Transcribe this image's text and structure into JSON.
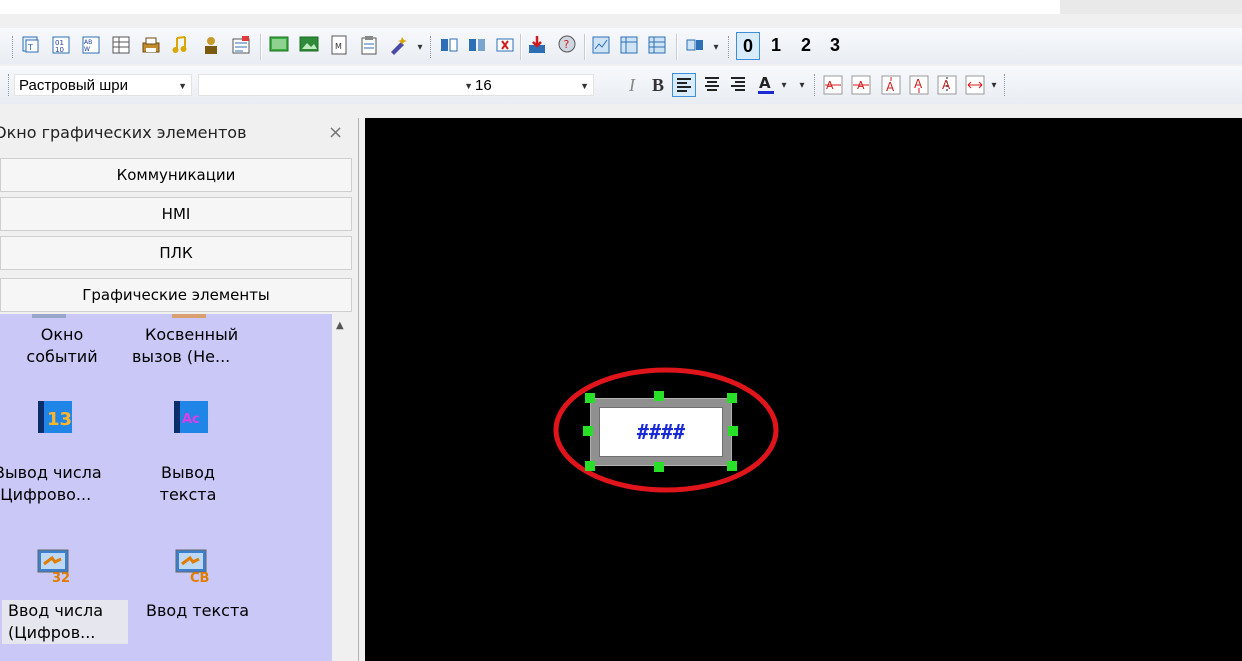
{
  "toolbar2": {
    "font_name": "Растровый шри",
    "font_size": "16",
    "italic": "I",
    "bold": "B"
  },
  "layer_numbers": [
    "0",
    "1",
    "2",
    "3"
  ],
  "panel": {
    "title": "Окно графических элементов",
    "close": "×",
    "categories": [
      "Коммуникации",
      "HMI",
      "ПЛК",
      "Графические элементы"
    ],
    "items": [
      {
        "label1": "Окно",
        "label2": "событий",
        "icon": "event-window-icon"
      },
      {
        "label1": "Косвенный",
        "label2": "вызов (Не...",
        "icon": "indirect-call-icon"
      },
      {
        "label1": "Вывод числа",
        "label2": "(Цифрово...",
        "icon": "numeric-display-icon"
      },
      {
        "label1": "Вывод",
        "label2": "текста",
        "icon": "text-display-icon"
      },
      {
        "label1": "Ввод числа",
        "label2": "(Цифров...",
        "icon": "numeric-input-icon"
      },
      {
        "label1": "Ввод текста",
        "label2": "",
        "icon": "text-input-icon"
      }
    ]
  },
  "canvas": {
    "widget_text": "####",
    "highlight_color": "#e0141b",
    "background": "#000000"
  }
}
